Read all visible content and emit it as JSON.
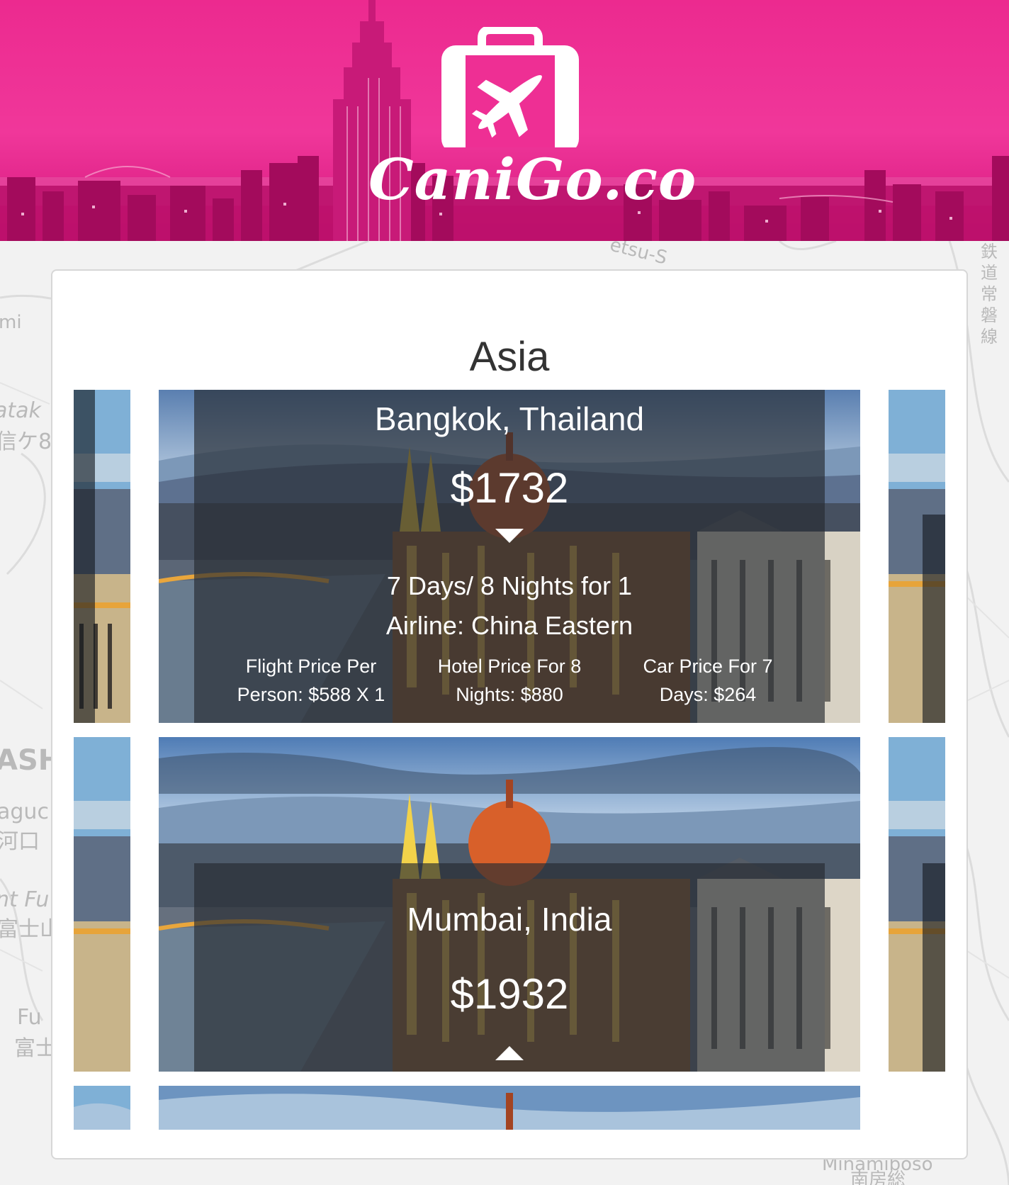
{
  "site": {
    "logo_text": "CaniGo.co",
    "brand_color": "#ec2a8f"
  },
  "region": {
    "title": "Asia"
  },
  "destinations": [
    {
      "city": "Bangkok, Thailand",
      "price": "$1732",
      "expanded": true,
      "duration": "7 Days/ 8 Nights for 1",
      "airline": "Airline: China Eastern",
      "flight_line1": "Flight Price Per",
      "flight_line2": "Person: $588 X 1",
      "hotel_line1": "Hotel Price For 8",
      "hotel_line2": "Nights: $880",
      "car_line1": "Car Price For 7",
      "car_line2": "Days: $264"
    },
    {
      "city": "Mumbai, India",
      "price": "$1932",
      "expanded": false
    }
  ],
  "map_labels": [
    "mi",
    "atak",
    "信ケ8",
    "ASH",
    "aguc",
    "河口",
    "nt Fu",
    "富士山",
    "Fu",
    "富士",
    "etsu-S",
    "鉄道常磐線",
    "Minamiboso",
    "南房総"
  ],
  "icons": [
    "suitcase-plane-icon",
    "chevron-down-icon",
    "chevron-up-icon"
  ]
}
